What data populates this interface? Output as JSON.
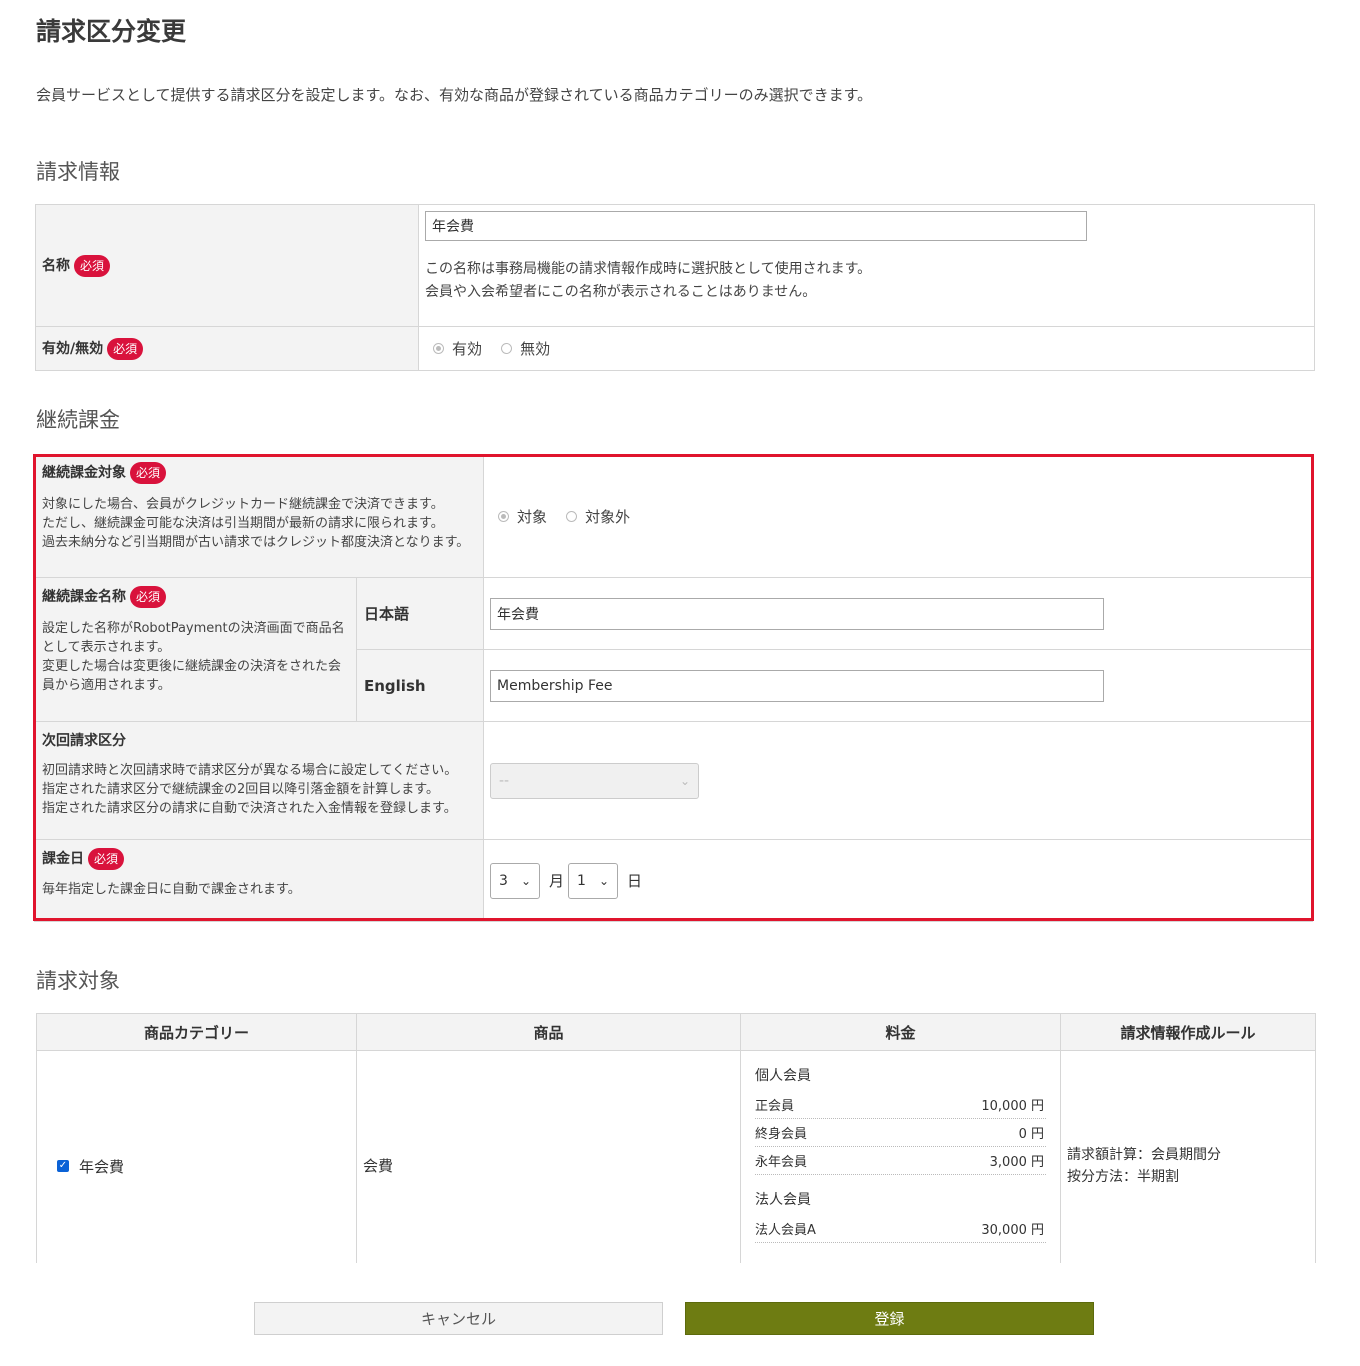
{
  "page": {
    "title": "請求区分変更",
    "description": "会員サービスとして提供する請求区分を設定します。なお、有効な商品が登録されている商品カテゴリーのみ選択できます。"
  },
  "billing_info": {
    "heading": "請求情報",
    "required_badge": "必須",
    "name_label": "名称",
    "name_value": "年会費",
    "name_hint_1": "この名称は事務局機能の請求情報作成時に選択肢として使用されます。",
    "name_hint_2": "会員や入会希望者にこの名称が表示されることはありません。",
    "status_label": "有効/無効",
    "status_options": [
      "有効",
      "無効"
    ],
    "status_selected": "有効"
  },
  "continuous": {
    "heading": "継続課金",
    "target_label": "継続課金対象",
    "target_hint_1": "対象にした場合、会員がクレジットカード継続課金で決済できます。",
    "target_hint_2": "ただし、継続課金可能な決済は引当期間が最新の請求に限られます。",
    "target_hint_3": "過去未納分など引当期間が古い請求ではクレジット都度決済となります。",
    "target_options": [
      "対象",
      "対象外"
    ],
    "target_selected": "対象",
    "name_label": "継続課金名称",
    "name_hint_1": "設定した名称がRobotPaymentの決済画面で商品名として表示されます。",
    "name_hint_2": "変更した場合は変更後に継続課金の決済をされた会員から適用されます。",
    "lang_ja_label": "日本語",
    "lang_ja_value": "年会費",
    "lang_en_label": "English",
    "lang_en_value": "Membership Fee",
    "next_label": "次回請求区分",
    "next_hint_1": "初回請求時と次回請求時で請求区分が異なる場合に設定してください。",
    "next_hint_2": "指定された請求区分で継続課金の2回目以降引落金額を計算します。",
    "next_hint_3": "指定された請求区分の請求に自動で決済された入金情報を登録します。",
    "next_value": "--",
    "day_label": "課金日",
    "day_hint": "毎年指定した課金日に自動で課金されます。",
    "month_value": "3",
    "month_unit": "月",
    "day_value": "1",
    "day_unit": "日"
  },
  "target": {
    "heading": "請求対象",
    "columns": [
      "商品カテゴリー",
      "商品",
      "料金",
      "請求情報作成ルール"
    ],
    "row": {
      "category": "年会費",
      "product": "会費",
      "groups": [
        {
          "name": "個人会員",
          "items": [
            {
              "name": "正会員",
              "price": "10,000 円"
            },
            {
              "name": "終身会員",
              "price": "0 円"
            },
            {
              "name": "永年会員",
              "price": "3,000 円"
            }
          ]
        },
        {
          "name": "法人会員",
          "items": [
            {
              "name": "法人会員A",
              "price": "30,000 円"
            }
          ]
        }
      ],
      "rule_1": "請求額計算：会員期間分",
      "rule_2": "按分方法：半期割"
    }
  },
  "buttons": {
    "cancel": "キャンセル",
    "submit": "登録"
  },
  "colors": {
    "required_badge": "#d9123c",
    "highlight_border": "#e0142d",
    "submit_button": "#6e7c12",
    "checkbox": "#0b62d6"
  }
}
